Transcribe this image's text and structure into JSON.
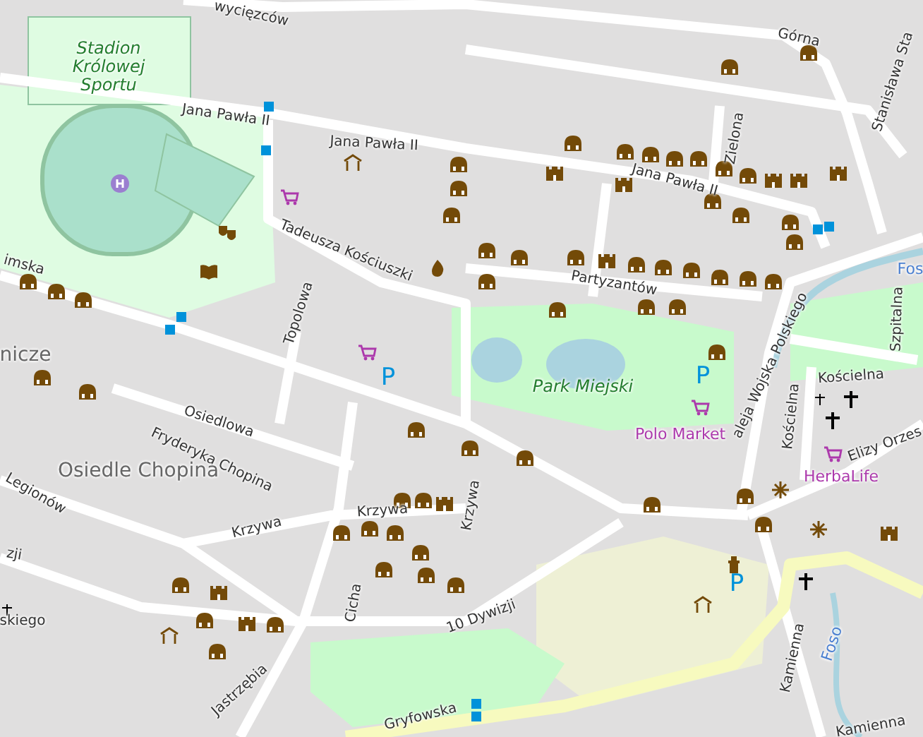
{
  "map": {
    "labels": [
      {
        "text": "wycięzców",
        "kind": "street"
      },
      {
        "text": "Stadion Królowej Sportu",
        "kind": "park"
      },
      {
        "text": "Jana Pawła II",
        "kind": "street"
      },
      {
        "text": "Jana Pawła II",
        "kind": "street"
      },
      {
        "text": "Tadeusza Kościuszki",
        "kind": "street"
      },
      {
        "text": "Topolowa",
        "kind": "street"
      },
      {
        "text": "imska",
        "kind": "street"
      },
      {
        "text": "Górna",
        "kind": "street"
      },
      {
        "text": "Stanisława Sta",
        "kind": "street"
      },
      {
        "text": "Zielona",
        "kind": "street"
      },
      {
        "text": "Jana Pawła II",
        "kind": "street"
      },
      {
        "text": "Partyzantów",
        "kind": "street"
      },
      {
        "text": "aleja Wojska Polskiego",
        "kind": "street"
      },
      {
        "text": "Fos",
        "kind": "water"
      },
      {
        "text": "Szpitalna",
        "kind": "street"
      },
      {
        "text": "Kościelna",
        "kind": "street"
      },
      {
        "text": "Kościelna",
        "kind": "street"
      },
      {
        "text": "Elizy Orzes",
        "kind": "street"
      },
      {
        "text": "Park Miejski",
        "kind": "park"
      },
      {
        "text": "Polo Market",
        "kind": "shop"
      },
      {
        "text": "HerbaLife",
        "kind": "shop"
      },
      {
        "text": "nicze",
        "kind": "district"
      },
      {
        "text": "Osiedlowa",
        "kind": "street"
      },
      {
        "text": "Fryderyka Chopina",
        "kind": "street"
      },
      {
        "text": "Osiedle Chopina",
        "kind": "district"
      },
      {
        "text": "Legionów",
        "kind": "street"
      },
      {
        "text": "Krzywa",
        "kind": "street"
      },
      {
        "text": "Krzywa",
        "kind": "street"
      },
      {
        "text": "Krzywa",
        "kind": "street"
      },
      {
        "text": "zji",
        "kind": "street"
      },
      {
        "text": "skiego",
        "kind": "street"
      },
      {
        "text": "Cicha",
        "kind": "street"
      },
      {
        "text": "10 Dywizji",
        "kind": "street"
      },
      {
        "text": "Jastrzębia",
        "kind": "street"
      },
      {
        "text": "Gryfowska",
        "kind": "street"
      },
      {
        "text": "Kamienna",
        "kind": "street"
      },
      {
        "text": "Foso",
        "kind": "water"
      },
      {
        "text": "Kamienna",
        "kind": "street"
      },
      {
        "text": "P",
        "kind": "parking"
      },
      {
        "text": "P",
        "kind": "parking"
      },
      {
        "text": "P",
        "kind": "parking"
      }
    ]
  }
}
